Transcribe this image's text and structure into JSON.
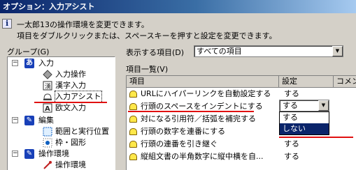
{
  "window": {
    "title": "オプション：入力アシスト"
  },
  "description": {
    "line1": "一太郎13の操作環境を変更できます。",
    "line2": "項目をダブルクリックまたは、スペースキーを押すと設定を変更できます。"
  },
  "group": {
    "label": "グループ(G)",
    "tree": [
      {
        "label": "入力",
        "expander": "−",
        "icon": "あ"
      },
      {
        "label": "入力操作"
      },
      {
        "label": "漢字入力"
      },
      {
        "label": "入力アシスト"
      },
      {
        "label": "欧文入力"
      },
      {
        "label": "編集",
        "expander": "−",
        "icon": "✎"
      },
      {
        "label": "範囲と実行位置"
      },
      {
        "label": "枠・図形"
      },
      {
        "label": "操作環境",
        "expander": "−",
        "icon": "✎"
      },
      {
        "label": "操作環境"
      }
    ]
  },
  "show_items": {
    "label": "表示する項目(D)",
    "value": "すべての項目"
  },
  "item_list": {
    "label": "項目一覧(V)",
    "columns": [
      "項目",
      "設定",
      "コメント"
    ],
    "rows": [
      {
        "item": "URLにハイパーリンクを自動設定する",
        "value": "する"
      },
      {
        "item": "行頭のスペースをインデントにする",
        "value": "する"
      },
      {
        "item": "対になる引用符／括弧を補完する",
        "value": ""
      },
      {
        "item": "行頭の数字を連番にする",
        "value": ""
      },
      {
        "item": "行頭の連番を引き継ぐ",
        "value": "する"
      },
      {
        "item": "縦組文書の半角数字に縦中横を自...",
        "value": "する"
      }
    ],
    "dropdown_options": [
      "する",
      "しない"
    ],
    "dropdown_selected": "しない"
  },
  "colors": {
    "titlebar": "#0a246a",
    "highlight": "#0a246a",
    "annotation": "#e01010"
  }
}
